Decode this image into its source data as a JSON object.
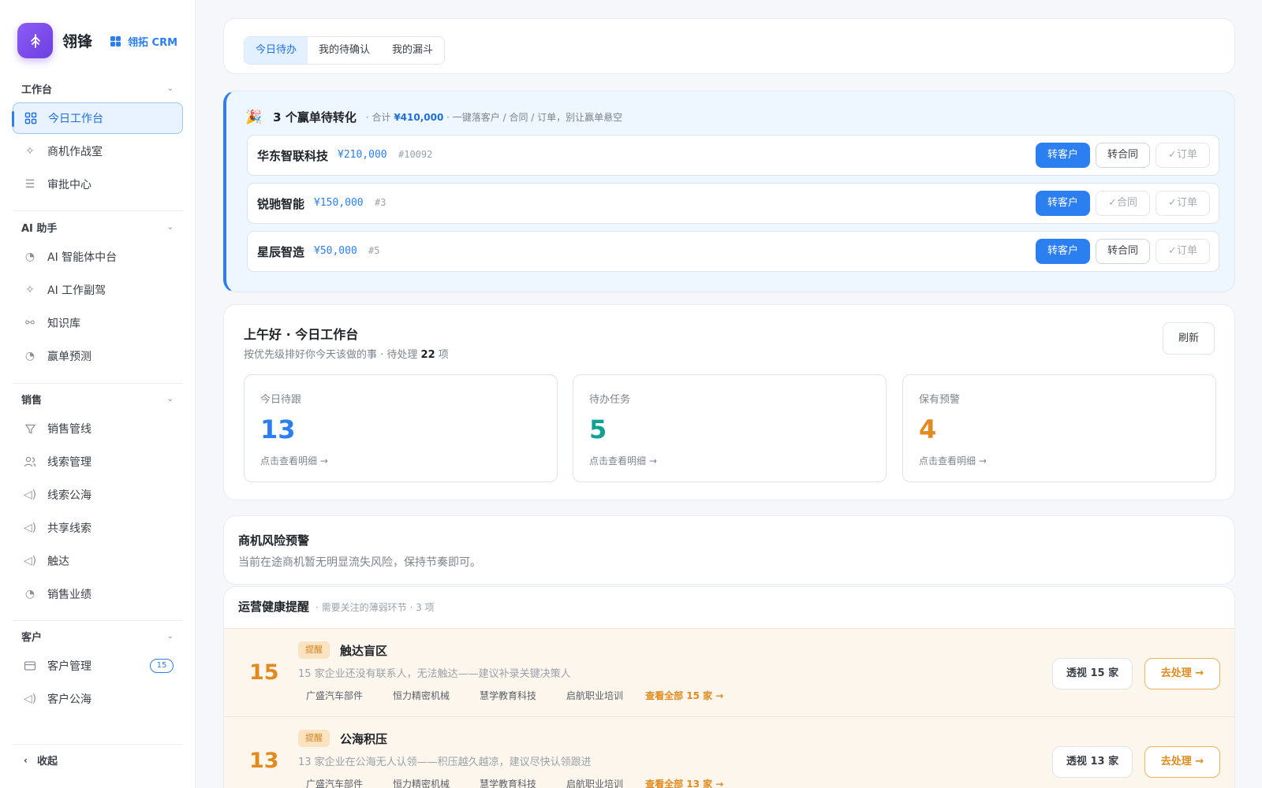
{
  "brand": {
    "name": "翎锋",
    "product": "翎拓 CRM"
  },
  "sidebar": {
    "sections": [
      {
        "title": "工作台",
        "items": [
          {
            "label": "今日工作台",
            "icon": "grid-icon",
            "active": true
          },
          {
            "label": "商机作战室",
            "icon": "sparkle-icon"
          },
          {
            "label": "审批中心",
            "icon": "list-icon"
          }
        ]
      },
      {
        "title": "AI 助手",
        "items": [
          {
            "label": "AI 智能体中台",
            "icon": "gauge-icon"
          },
          {
            "label": "AI 工作副驾",
            "icon": "sparkle-icon"
          },
          {
            "label": "知识库",
            "icon": "link-icon"
          },
          {
            "label": "赢单预测",
            "icon": "gauge-icon"
          }
        ]
      },
      {
        "title": "销售",
        "items": [
          {
            "label": "销售管线",
            "icon": "filter-icon"
          },
          {
            "label": "线索管理",
            "icon": "users-icon"
          },
          {
            "label": "线索公海",
            "icon": "megaphone-icon"
          },
          {
            "label": "共享线索",
            "icon": "megaphone-icon"
          },
          {
            "label": "触达",
            "icon": "megaphone-icon"
          },
          {
            "label": "销售业绩",
            "icon": "gauge-icon"
          }
        ]
      },
      {
        "title": "客户",
        "items": [
          {
            "label": "客户管理",
            "icon": "card-icon",
            "count": "15"
          },
          {
            "label": "客户公海",
            "icon": "megaphone-icon"
          }
        ]
      }
    ],
    "collapse_label": "收起"
  },
  "tabs": [
    "今日待办",
    "我的待确认",
    "我的漏斗"
  ],
  "wins": {
    "title": "3 个赢单待转化",
    "sub_prefix": "· 合计",
    "sub_total": "¥410,000",
    "sub_suffix": "· 一键落客户 / 合同 / 订单，别让赢单悬空",
    "rows": [
      {
        "name": "华东智联科技",
        "amount": "¥210,000",
        "id": "#10092",
        "b1": "转客户",
        "b2": "转合同",
        "b3": "✓订单",
        "b2_done": false
      },
      {
        "name": "锐驰智能",
        "amount": "¥150,000",
        "id": "#3",
        "b1": "转客户",
        "b2": "✓合同",
        "b3": "✓订单",
        "b2_done": true
      },
      {
        "name": "星辰智造",
        "amount": "¥50,000",
        "id": "#5",
        "b1": "转客户",
        "b2": "转合同",
        "b3": "✓订单",
        "b2_done": false
      }
    ]
  },
  "today": {
    "title": "上午好 · 今日工作台",
    "sub_prefix": "按优先级排好你今天该做的事 · 待处理",
    "pending": "22",
    "sub_suffix": "项",
    "refresh": "刷新",
    "stats": [
      {
        "label": "今日待跟",
        "value": "13",
        "color": "#2b7ff0",
        "link": "点击查看明细 →"
      },
      {
        "label": "待办任务",
        "value": "5",
        "color": "#10a196",
        "link": "点击查看明细 →"
      },
      {
        "label": "保有预警",
        "value": "4",
        "color": "#e08a1f",
        "link": "点击查看明细 →"
      }
    ]
  },
  "risk": {
    "title": "商机风险预警",
    "sub": "当前在途商机暂无明显流失风险，保持节奏即可。"
  },
  "health": {
    "title": "运营健康提醒",
    "sub": "· 需要关注的薄弱环节 · 3 项",
    "rows": [
      {
        "count": "15",
        "tag": "提醒",
        "title": "触达盲区",
        "desc": "15 家企业还没有联系人，无法触达——建议补录关键决策人",
        "chips": [
          "广盛汽车部件",
          "恒力精密机械",
          "慧学教育科技",
          "启航职业培训"
        ],
        "more": "查看全部 15 家 →",
        "btn1": "透视 15 家",
        "btn2": "去处理 →"
      },
      {
        "count": "13",
        "tag": "提醒",
        "title": "公海积压",
        "desc": "13 家企业在公海无人认领——积压越久越凉，建议尽快认领跟进",
        "chips": [
          "广盛汽车部件",
          "恒力精密机械",
          "慧学教育科技",
          "启航职业培训"
        ],
        "more": "查看全部 13 家 →",
        "btn1": "透视 13 家",
        "btn2": "去处理 →"
      }
    ]
  }
}
